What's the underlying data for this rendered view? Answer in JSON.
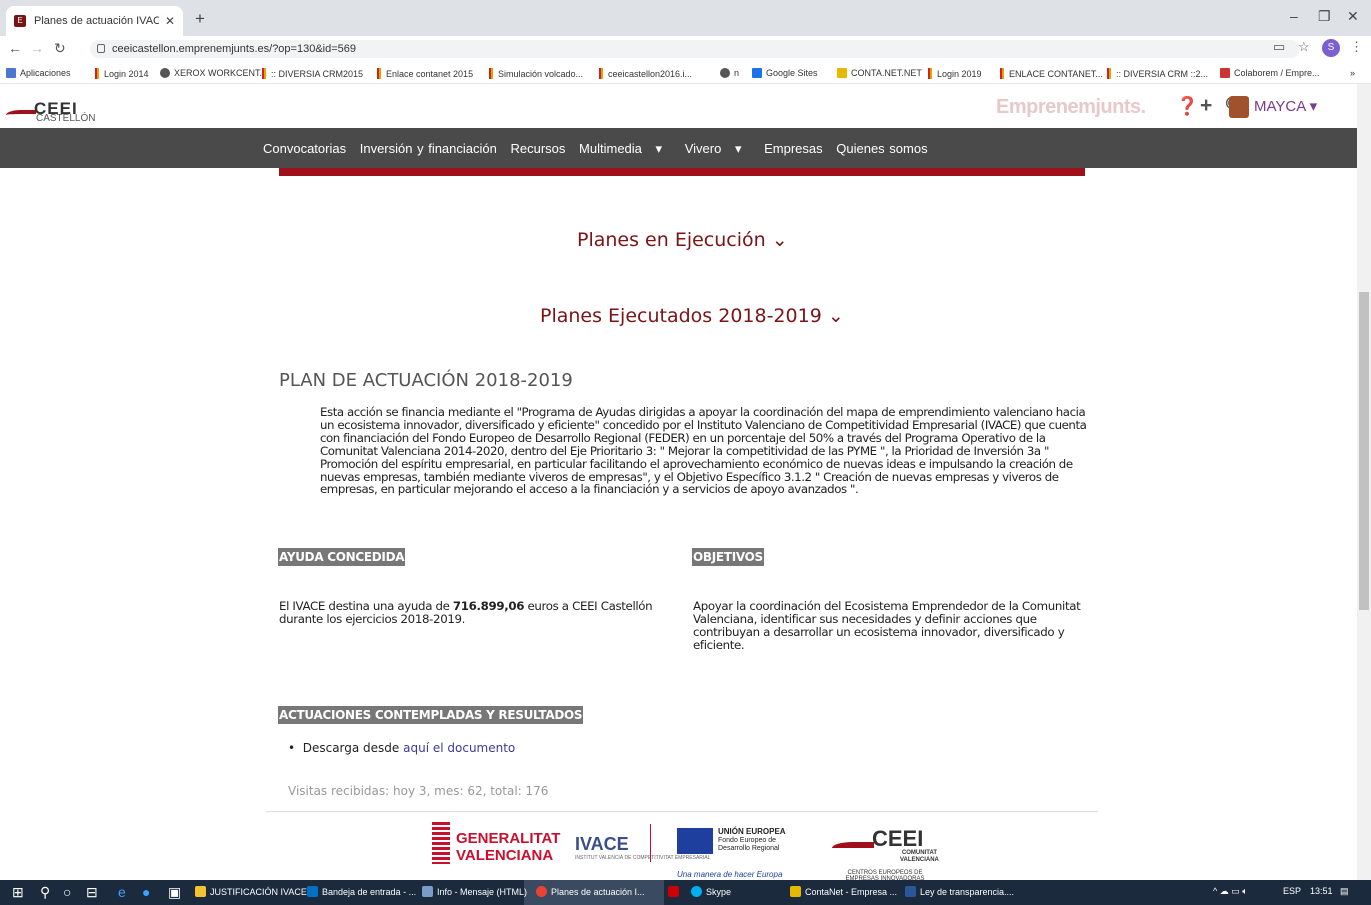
{
  "browser": {
    "tab_title": "Planes de actuación IVACE - CEE",
    "url": "ceeicastellon.emprenemjunts.es/?op=130&id=569",
    "bookmarks": [
      "Aplicaciones",
      "Login 2014",
      "XEROX WORKCENT...",
      ":: DIVERSIA CRM2015",
      "Enlace contanet 2015",
      "Simulación volcado...",
      "ceeicastellon2016.i...",
      "n",
      "Google Sites",
      "CONTA.NET.NET",
      "Login 2019",
      "ENLACE CONTANET...",
      ":: DIVERSIA CRM ::2...",
      "Colaborem / Empre..."
    ],
    "profile_initial": "S"
  },
  "site": {
    "logo_main": "CEEI",
    "logo_sub": "CASTELLÓN",
    "brand": "Emprenemjunts.",
    "user": "MAYCA",
    "menu": [
      "Convocatorias",
      "Inversión y financiación",
      "Recursos",
      "Multimedia",
      "Vivero",
      "Empresas",
      "Quienes somos"
    ]
  },
  "content": {
    "section_exec": "Planes en Ejecución",
    "section_done": "Planes Ejecutados 2018-2019",
    "plan_title": "PLAN DE ACTUACIÓN 2018-2019",
    "intro": "Esta acción se financia mediante el \"Programa de Ayudas dirigidas a apoyar la coordinación del mapa de emprendimiento valenciano hacia un ecosistema innovador, diversificado y eficiente\" concedido por el Instituto Valenciano de Competitividad Empresarial (IVACE) que cuenta con financiación del Fondo Europeo de Desarrollo Regional (FEDER) en un porcentaje del 50% a través del Programa Operativo de la Comunitat Valenciana 2014-2020, dentro del Eje Prioritario 3: \" Mejorar la competitividad de las PYME \", la Prioridad de Inversión 3a \" Promoción del espíritu empresarial, en particular facilitando el aprovechamiento económico de nuevas ideas e impulsando la creación de nuevas empresas, también mediante viveros de empresas\", y el Objetivo Específico 3.1.2 \" Creación de nuevas empresas y viveros de empresas, en particular mejorando el acceso a la financiación y a servicios de apoyo avanzados \".",
    "ayuda_heading": "AYUDA CONCEDIDA",
    "ayuda_pre": " El IVACE destina una ayuda de ",
    "ayuda_amount": "716.899,06",
    "ayuda_post": " euros a CEEI Castellón durante los ejercicios 2018-2019.",
    "objetivos_heading": "OBJETIVOS",
    "objetivos_text": " Apoyar la coordinación del Ecosistema Emprendedor de la Comunitat Valenciana, identificar sus necesidades y definir acciones que contribuyan a desarrollar un ecosistema innovador, diversificado y eficiente.",
    "actuaciones_heading": "ACTUACIONES CONTEMPLADAS Y RESULTADOS",
    "download_pre": "Descarga desde ",
    "download_link": "aquí el documento",
    "visits": "Visitas recibidas: hoy 3, mes: 62, total: 176"
  },
  "footer": {
    "gen_line1": "GENERALITAT",
    "gen_line2": "VALENCIANA",
    "ivace": "IVACE",
    "ivace_sub": "INSTITUT VALENCIÀ DE COMPETITIVITAT EMPRESARIAL",
    "eu_title": "UNIÓN EUROPEA",
    "eu_sub1": "Fondo Europeo de",
    "eu_sub2": "Desarrollo Regional",
    "eu_motto": "Una manera de hacer Europa",
    "ceei": "CEEI",
    "ceei_sub1": "COMUNITAT",
    "ceei_sub2": "VALENCIANA",
    "ceei_caption": "CENTROS EUROPEOS DE EMPRESAS INNOVADORAS"
  },
  "taskbar": {
    "items": [
      "JUSTIFICACIÓN IVACE...",
      "Bandeja de entrada - ...",
      "Info - Mensaje (HTML)",
      "Planes de actuación I...",
      "Skype",
      "ContaNet - Empresa ...",
      "Ley de transparencia...."
    ],
    "lang": "ESP",
    "time": "13:51"
  }
}
